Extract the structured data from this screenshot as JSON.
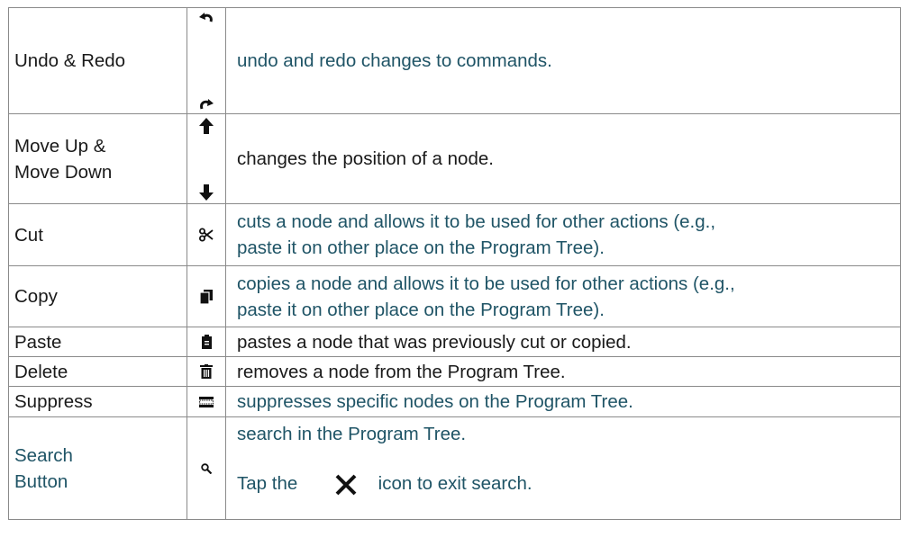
{
  "rows": [
    {
      "name": "Undo & Redo",
      "icons": [
        "undo-icon",
        "redo-icon"
      ],
      "desc": "undo and redo changes to commands."
    },
    {
      "name": "Move Up & Move Down",
      "name_lines": [
        "Move Up &",
        "Move Down"
      ],
      "icons": [
        "arrow-up-icon",
        "arrow-down-icon"
      ],
      "desc": "changes the position of a node."
    },
    {
      "name": "Cut",
      "icons": [
        "scissors-icon"
      ],
      "desc_lines": [
        "cuts a node and allows it to be used for other actions (e.g.,",
        "paste it on other place on the Program Tree)."
      ]
    },
    {
      "name": "Copy",
      "icons": [
        "copy-icon"
      ],
      "desc_lines": [
        "copies a node and allows it to be used for other actions (e.g.,",
        "paste it on other place on the Program Tree)."
      ]
    },
    {
      "name": "Paste",
      "icons": [
        "paste-icon"
      ],
      "desc": "pastes a node that was previously cut or copied."
    },
    {
      "name": "Delete",
      "icons": [
        "trash-icon"
      ],
      "desc": "removes a node from the Program Tree."
    },
    {
      "name": "Suppress",
      "icons": [
        "suppress-icon"
      ],
      "desc": "suppresses specific nodes on the Program Tree."
    },
    {
      "name_lines": [
        "Search",
        "Button"
      ],
      "icons": [
        "search-icon"
      ],
      "desc": "search in the Program Tree.",
      "desc2_pre": "Tap the",
      "desc2_icon": "close-icon",
      "desc2_post": "icon to exit search."
    }
  ],
  "colors": {
    "teal_text": "#1f5466",
    "dark_text": "#1a1a1a",
    "border": "#8a8a8a"
  }
}
